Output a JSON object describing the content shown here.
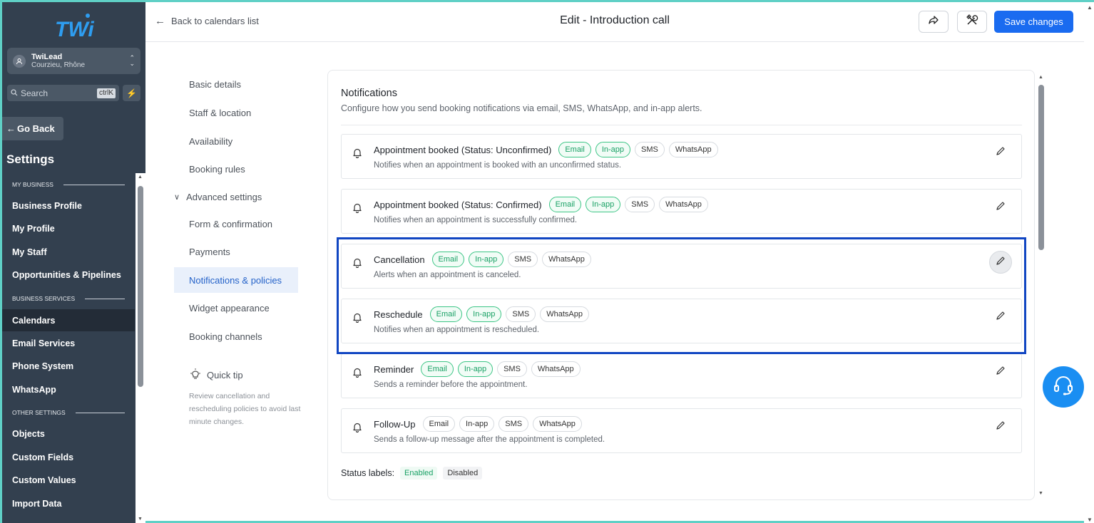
{
  "app": {
    "brand": "TWi",
    "accent": "#1a6bf0"
  },
  "account": {
    "name": "TwiLead",
    "location": "Courzieu, Rhône"
  },
  "search": {
    "placeholder": "Search",
    "shortcut": "ctrlK"
  },
  "sidebar": {
    "go_back": "Go Back",
    "title": "Settings",
    "sections": [
      {
        "label": "MY BUSINESS"
      },
      {
        "label": "BUSINESS SERVICES"
      },
      {
        "label": "OTHER SETTINGS"
      }
    ],
    "items": [
      {
        "label": "Business Profile"
      },
      {
        "label": "My Profile"
      },
      {
        "label": "My Staff"
      },
      {
        "label": "Opportunities & Pipelines"
      },
      {
        "label": "Calendars",
        "active": true
      },
      {
        "label": "Email Services"
      },
      {
        "label": "Phone System"
      },
      {
        "label": "WhatsApp"
      },
      {
        "label": "Objects"
      },
      {
        "label": "Custom Fields"
      },
      {
        "label": "Custom Values"
      },
      {
        "label": "Import Data"
      }
    ]
  },
  "header": {
    "back_label": "Back to calendars list",
    "title": "Edit - Introduction call",
    "save_label": "Save changes"
  },
  "subnav": {
    "items": [
      {
        "label": "Basic details"
      },
      {
        "label": "Staff & location"
      },
      {
        "label": "Availability"
      },
      {
        "label": "Booking rules"
      },
      {
        "label": "Advanced settings"
      },
      {
        "label": "Form & confirmation"
      },
      {
        "label": "Payments"
      },
      {
        "label": "Notifications & policies",
        "active": true
      },
      {
        "label": "Widget appearance"
      },
      {
        "label": "Booking channels"
      }
    ],
    "tip_title": "Quick tip",
    "tip_body": "Review cancellation and rescheduling policies to avoid last minute changes."
  },
  "notifications": {
    "title": "Notifications",
    "description": "Configure how you send booking notifications via email, SMS, WhatsApp, and in-app alerts.",
    "channels": [
      "Email",
      "In-app",
      "SMS",
      "WhatsApp"
    ],
    "items": [
      {
        "title": "Appointment booked (Status: Unconfirmed)",
        "description": "Notifies when an appointment is booked with an unconfirmed status.",
        "enabled": [
          "Email",
          "In-app"
        ]
      },
      {
        "title": "Appointment booked (Status: Confirmed)",
        "description": "Notifies when an appointment is successfully confirmed.",
        "enabled": [
          "Email",
          "In-app"
        ]
      },
      {
        "title": "Cancellation",
        "description": "Alerts when an appointment is canceled.",
        "enabled": [
          "Email",
          "In-app"
        ]
      },
      {
        "title": "Reschedule",
        "description": "Notifies when an appointment is rescheduled.",
        "enabled": [
          "Email",
          "In-app"
        ]
      },
      {
        "title": "Reminder",
        "description": "Sends a reminder before the appointment.",
        "enabled": [
          "Email",
          "In-app"
        ]
      },
      {
        "title": "Follow-Up",
        "description": "Sends a follow-up message after the appointment is completed.",
        "enabled": []
      }
    ],
    "status_label": "Status labels:",
    "status_enabled": "Enabled",
    "status_disabled": "Disabled"
  }
}
